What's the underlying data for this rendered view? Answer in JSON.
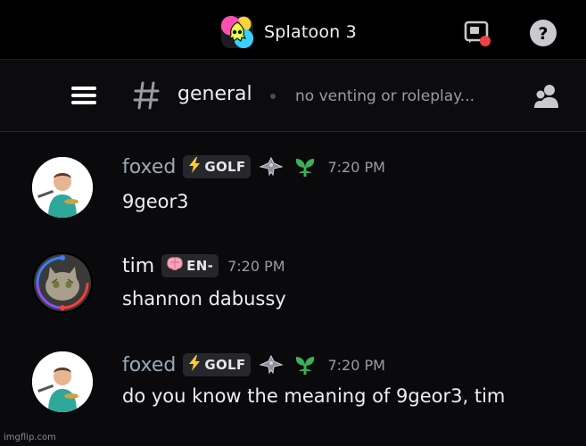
{
  "server": {
    "name": "Splatoon 3",
    "icon": "splatoon-squid-icon"
  },
  "top_icons": [
    "stage-discovery-icon",
    "help-icon"
  ],
  "channel": {
    "name": "general",
    "topic": "no venting or roleplay..."
  },
  "messages": [
    {
      "username": "foxed",
      "username_color": "#9aa8b8",
      "role_tag": "GOLF",
      "role_tag_icon": "lightning-icon",
      "badges": [
        "spaceship-icon",
        "plant-icon"
      ],
      "time": "7:20 PM",
      "text": "9geor3"
    },
    {
      "username": "tim",
      "username_color": "#f2f2f4",
      "role_tag": "EN-",
      "role_tag_icon": "brain-icon",
      "badges": [],
      "time": "7:20 PM",
      "text": "shannon dabussy"
    },
    {
      "username": "foxed",
      "username_color": "#9aa8b8",
      "role_tag": "GOLF",
      "role_tag_icon": "lightning-icon",
      "badges": [
        "spaceship-icon",
        "plant-icon"
      ],
      "time": "7:20 PM",
      "text": "do you know the meaning of 9geor3, tim"
    }
  ],
  "watermark": "imgflip.com"
}
